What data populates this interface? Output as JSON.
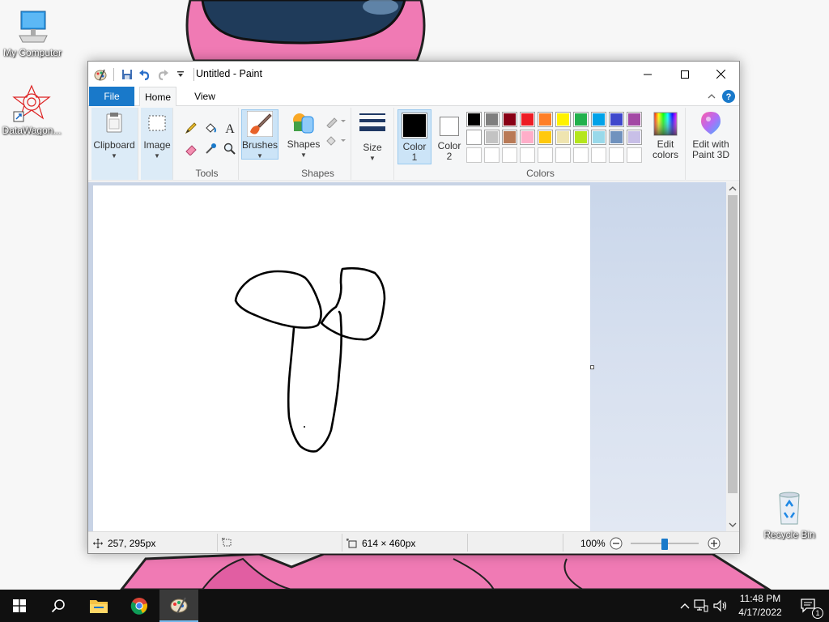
{
  "desktop": {
    "icons": [
      {
        "label": "My Computer"
      },
      {
        "label": "DataWagon..."
      },
      {
        "label": "Recycle Bin"
      }
    ]
  },
  "window": {
    "title": "Untitled - Paint",
    "tabs": {
      "file": "File",
      "home": "Home",
      "view": "View"
    },
    "groups": {
      "clipboard": {
        "label": "Clipboard"
      },
      "image": {
        "label": "Image"
      },
      "tools": {
        "label": "Tools"
      },
      "brushes": {
        "label": "Brushes"
      },
      "shapes_btn": {
        "label": "Shapes"
      },
      "shapes": {
        "label": "Shapes"
      },
      "size": {
        "label": "Size"
      },
      "color1": {
        "label_line1": "Color",
        "label_line2": "1"
      },
      "color2": {
        "label_line1": "Color",
        "label_line2": "2"
      },
      "colors": {
        "label": "Colors"
      },
      "edit_colors": {
        "label_line1": "Edit",
        "label_line2": "colors"
      },
      "paint3d": {
        "label_line1": "Edit with",
        "label_line2": "Paint 3D"
      }
    },
    "palette_row1": [
      "#000000",
      "#7f7f7f",
      "#880015",
      "#ed1c24",
      "#ff7f27",
      "#fff200",
      "#22b14c",
      "#00a2e8",
      "#3f48cc",
      "#a349a4"
    ],
    "palette_row2": [
      "#ffffff",
      "#c3c3c3",
      "#b97a57",
      "#ffaec9",
      "#ffc90e",
      "#efe4b0",
      "#b5e61d",
      "#99d9ea",
      "#7092be",
      "#c8bfe7"
    ],
    "palette_row3": [
      "#ffffff",
      "#ffffff",
      "#ffffff",
      "#ffffff",
      "#ffffff",
      "#ffffff",
      "#ffffff",
      "#ffffff",
      "#ffffff",
      "#ffffff"
    ],
    "color1_value": "#000000",
    "color2_value": "#ffffff",
    "status": {
      "cursor_pos": "257, 295px",
      "selection_size": "",
      "canvas_size": "614 × 460px",
      "zoom": "100%"
    }
  },
  "taskbar": {
    "time": "11:48 PM",
    "date": "4/17/2022",
    "notification_count": "1"
  }
}
